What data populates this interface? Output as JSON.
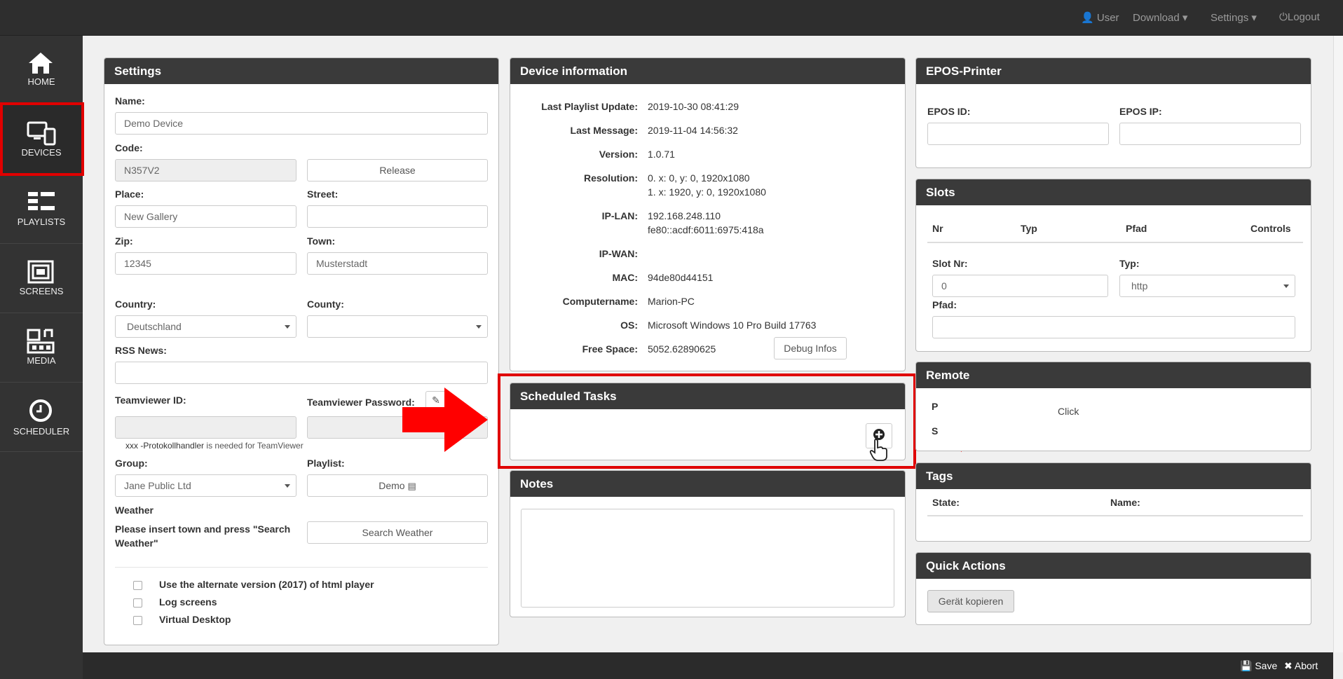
{
  "topbar": {
    "user": "User",
    "download": "Download",
    "settings": "Settings",
    "logout": "Logout"
  },
  "sidebar": {
    "items": [
      {
        "label": "HOME"
      },
      {
        "label": "DEVICES"
      },
      {
        "label": "PLAYLISTS"
      },
      {
        "label": "SCREENS"
      },
      {
        "label": "MEDIA"
      },
      {
        "label": "SCHEDULER"
      }
    ]
  },
  "settings": {
    "title": "Settings",
    "name_label": "Name:",
    "name_value": "Demo Device",
    "code_label": "Code:",
    "code_value": "N357V2",
    "release": "Release",
    "place_label": "Place:",
    "place_value": "New Gallery",
    "street_label": "Street:",
    "street_value": "",
    "zip_label": "Zip:",
    "zip_value": "12345",
    "town_label": "Town:",
    "town_value": "Musterstadt",
    "country_label": "Country:",
    "country_value": "Deutschland",
    "county_label": "County:",
    "county_value": "",
    "rss_label": "RSS News:",
    "rss_value": "",
    "tv_id_label": "Teamviewer ID:",
    "tv_pw_label": "Teamviewer Password:",
    "tv_hint_a": "xxx -Protokollhandler",
    "tv_hint_b": " is needed for TeamViewer",
    "group_label": "Group:",
    "group_value": "Jane Public Ltd",
    "playlist_label": "Playlist:",
    "playlist_value": "Demo",
    "weather_label": "Weather",
    "weather_hint": "Please insert town and press \"Search Weather\"",
    "search_weather": "Search Weather",
    "chk_alt": "Use the alternate version (2017) of html player",
    "chk_log": "Log screens",
    "chk_virtual": "Virtual Desktop"
  },
  "device_info": {
    "title": "Device information",
    "rows": [
      {
        "k": "Last Playlist Update:",
        "v": "2019-10-30 08:41:29"
      },
      {
        "k": "Last Message:",
        "v": "2019-11-04 14:56:32"
      },
      {
        "k": "Version:",
        "v": "1.0.71"
      },
      {
        "k": "Resolution:",
        "v": "0. x: 0, y: 0, 1920x1080",
        "v2": "1. x: 1920, y: 0, 1920x1080"
      },
      {
        "k": "IP-LAN:",
        "v": "192.168.248.110",
        "v2": "fe80::acdf:6011:6975:418a"
      },
      {
        "k": "IP-WAN:",
        "v": ""
      },
      {
        "k": "MAC:",
        "v": "94de80d44151"
      },
      {
        "k": "Computername:",
        "v": "Marion-PC"
      },
      {
        "k": "OS:",
        "v": "Microsoft Windows 10 Pro Build 17763"
      },
      {
        "k": "Free Space:",
        "v": "5052.62890625"
      }
    ],
    "debug": "Debug Infos"
  },
  "scheduled": {
    "title": "Scheduled Tasks"
  },
  "notes": {
    "title": "Notes"
  },
  "epos": {
    "title": "EPOS-Printer",
    "id_label": "EPOS ID:",
    "ip_label": "EPOS IP:"
  },
  "slots": {
    "title": "Slots",
    "cols": [
      "Nr",
      "Typ",
      "Pfad",
      "Controls"
    ],
    "slot_nr_label": "Slot Nr:",
    "slot_nr_value": "0",
    "typ_label": "Typ:",
    "typ_value": "http",
    "pfad_label": "Pfad:"
  },
  "remote": {
    "title": "Remote",
    "click": "Click",
    "row1": "P",
    "row2": "S"
  },
  "tags": {
    "title": "Tags",
    "state": "State:",
    "name": "Name:"
  },
  "quick": {
    "title": "Quick Actions",
    "copy": "Gerät kopieren"
  },
  "footer": {
    "save": "Save",
    "abort": "Abort"
  },
  "colors": {
    "highlight": "#e00000",
    "header": "#3a3a3a",
    "sidebar": "#333333"
  }
}
